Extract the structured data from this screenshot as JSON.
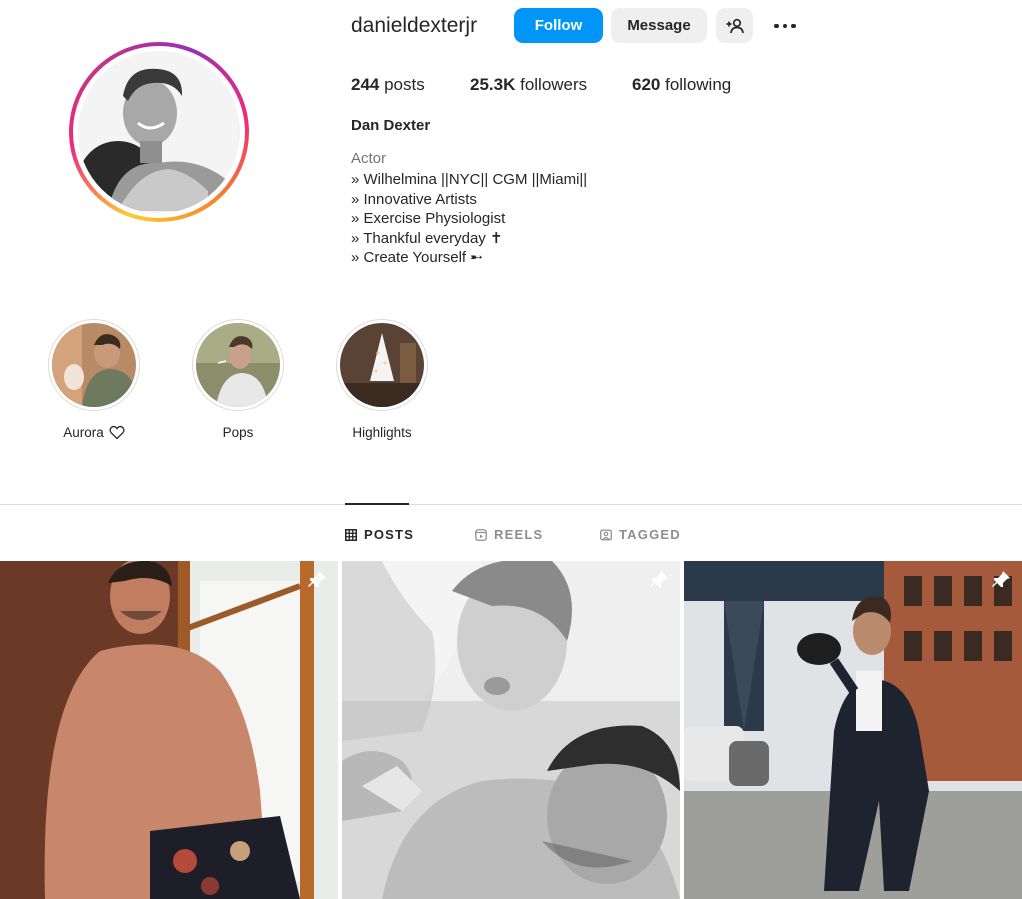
{
  "profile": {
    "username": "danieldexterjr",
    "full_name": "Dan Dexter",
    "category": "Actor",
    "bio_lines": [
      "» Wilhelmina ||NYC|| CGM ||Miami||",
      "» Innovative Artists",
      "» Exercise Physiologist",
      "» Thankful everyday ✝",
      "» Create Yourself ➸"
    ],
    "avatar_icon": "profile-photo"
  },
  "actions": {
    "follow_label": "Follow",
    "message_label": "Message",
    "add_user_icon": "add-user-icon",
    "more_icon": "more-options-icon"
  },
  "stats": {
    "posts_count": "244",
    "posts_label": " posts",
    "followers_count": "25.3K",
    "followers_label": " followers",
    "following_count": "620",
    "following_label": " following"
  },
  "highlights": [
    {
      "label": "Aurora",
      "icon": "heart-outline-icon"
    },
    {
      "label": "Pops"
    },
    {
      "label": "Highlights"
    }
  ],
  "tabs": {
    "posts": "POSTS",
    "reels": "REELS",
    "tagged": "TAGGED"
  },
  "colors": {
    "accent": "#0095f6",
    "text": "#262626",
    "muted": "#737373",
    "border": "#dbdbdb"
  }
}
